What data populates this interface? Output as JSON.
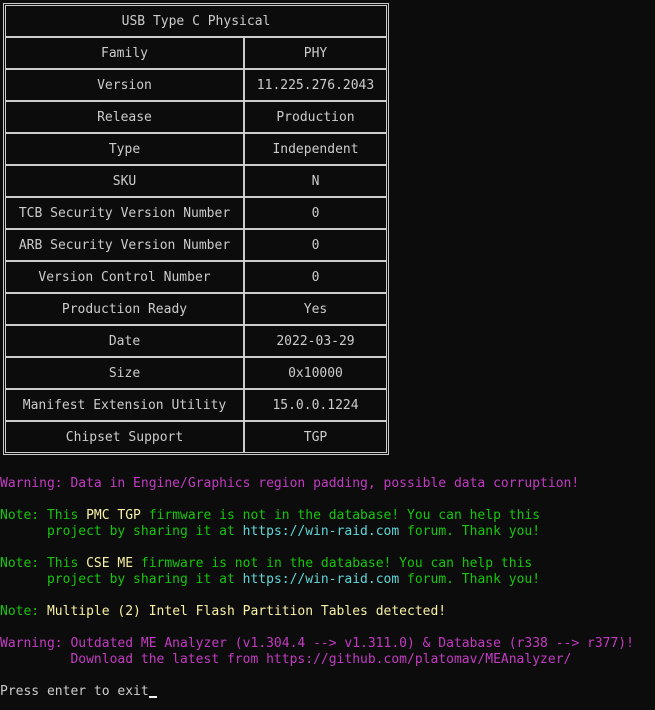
{
  "table": {
    "title": "USB Type C Physical",
    "rows": [
      {
        "key": "Family",
        "value": "PHY"
      },
      {
        "key": "Version",
        "value": "11.225.276.2043"
      },
      {
        "key": "Release",
        "value": "Production"
      },
      {
        "key": "Type",
        "value": "Independent"
      },
      {
        "key": "SKU",
        "value": "N"
      },
      {
        "key": "TCB Security Version Number",
        "value": "0"
      },
      {
        "key": "ARB Security Version Number",
        "value": "0"
      },
      {
        "key": "Version Control Number",
        "value": "0"
      },
      {
        "key": "Production Ready",
        "value": "Yes"
      },
      {
        "key": "Date",
        "value": "2022-03-29"
      },
      {
        "key": "Size",
        "value": "0x10000"
      },
      {
        "key": "Manifest Extension Utility",
        "value": "15.0.0.1224"
      },
      {
        "key": "Chipset Support",
        "value": "TGP"
      }
    ]
  },
  "messages": {
    "warn_padding": "Warning: Data in Engine/Graphics region padding, possible data corruption!",
    "note1_prefix": "Note: This ",
    "note1_fw": "PMC TGP",
    "note1_mid": " firmware is not in the database! You can help this",
    "note1_line2a": "      project by sharing it at ",
    "note1_link": "https://win-raid.com",
    "note1_line2b": " forum. Thank you!",
    "note2_prefix": "Note: This ",
    "note2_fw": "CSE ME",
    "note2_mid": " firmware is not in the database! You can help this",
    "note2_line2a": "      project by sharing it at ",
    "note2_link": "https://win-raid.com",
    "note2_line2b": " forum. Thank you!",
    "note3_prefix": "Note: ",
    "note3_text": "Multiple (2) Intel Flash Partition Tables detected!",
    "warn_outdated_1": "Warning: Outdated ME Analyzer (v1.304.4 --> v1.311.0) & Database (r338 --> r377)!",
    "warn_outdated_2": "         Download the latest from https://github.com/platomav/MEAnalyzer/",
    "prompt": "Press enter to exit"
  },
  "colors": {
    "background": "#0c0c0c",
    "text": "#cccccc",
    "warning": "#c23bc2",
    "note": "#16c60c",
    "firmware_name": "#f9f1a5",
    "link": "#61d6d6"
  }
}
